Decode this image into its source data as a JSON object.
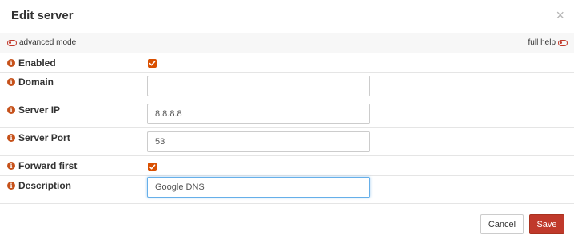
{
  "dialog": {
    "title": "Edit server",
    "close_symbol": "×"
  },
  "mode_bar": {
    "advanced_mode_label": "advanced mode",
    "full_help_label": "full help"
  },
  "fields": {
    "enabled": {
      "label": "Enabled",
      "checked": true
    },
    "domain": {
      "label": "Domain",
      "value": ""
    },
    "server_ip": {
      "label": "Server IP",
      "value": "8.8.8.8"
    },
    "server_port": {
      "label": "Server Port",
      "value": "53"
    },
    "forward_first": {
      "label": "Forward first",
      "checked": true
    },
    "description": {
      "label": "Description",
      "value": "Google DNS"
    }
  },
  "buttons": {
    "cancel_label": "Cancel",
    "save_label": "Save"
  },
  "colors": {
    "accent": "#c0392b",
    "info_icon": "#c6511a",
    "checkbox": "#d94f00"
  },
  "icons": {
    "info": "info-icon",
    "toggle": "toggle-off-icon",
    "check": "checkmark-icon",
    "close": "close-icon"
  }
}
